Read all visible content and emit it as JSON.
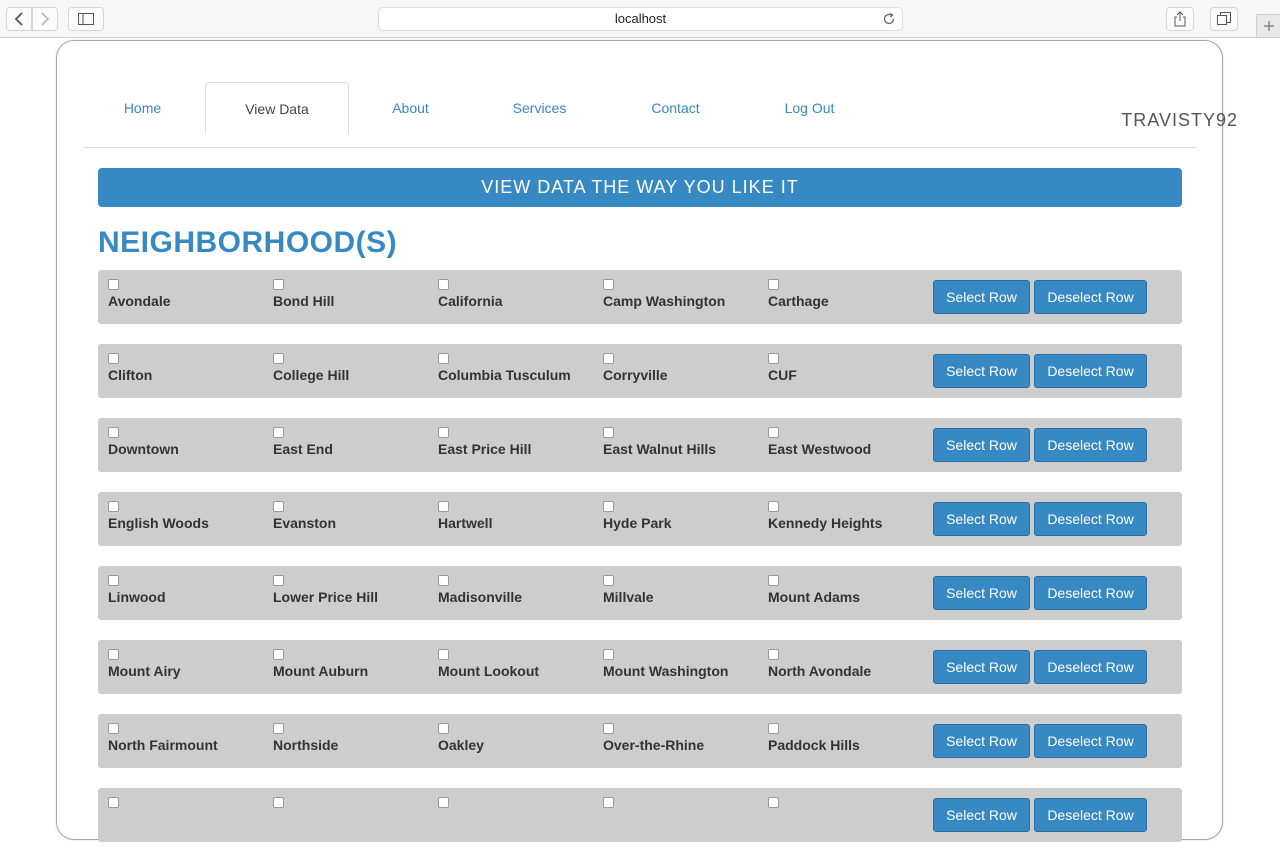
{
  "browser": {
    "url": "localhost"
  },
  "nav": {
    "tabs": [
      {
        "label": "Home",
        "active": false
      },
      {
        "label": "View Data",
        "active": true
      },
      {
        "label": "About",
        "active": false
      },
      {
        "label": "Services",
        "active": false
      },
      {
        "label": "Contact",
        "active": false
      },
      {
        "label": "Log Out",
        "active": false
      }
    ],
    "username": "TRAVISTY92"
  },
  "banner": "VIEW DATA THE WAY YOU LIKE IT",
  "section_title": "NEIGHBORHOOD(S)",
  "row_buttons": {
    "select": "Select Row",
    "deselect": "Deselect Row"
  },
  "rows": [
    [
      "Avondale",
      "Bond Hill",
      "California",
      "Camp Washington",
      "Carthage"
    ],
    [
      "Clifton",
      "College Hill",
      "Columbia Tusculum",
      "Corryville",
      "CUF"
    ],
    [
      "Downtown",
      "East End",
      "East Price Hill",
      "East Walnut Hills",
      "East Westwood"
    ],
    [
      "English Woods",
      "Evanston",
      "Hartwell",
      "Hyde Park",
      "Kennedy Heights"
    ],
    [
      "Linwood",
      "Lower Price Hill",
      "Madisonville",
      "Millvale",
      "Mount Adams"
    ],
    [
      "Mount Airy",
      "Mount Auburn",
      "Mount Lookout",
      "Mount Washington",
      "North Avondale"
    ],
    [
      "North Fairmount",
      "Northside",
      "Oakley",
      "Over-the-Rhine",
      "Paddock Hills"
    ],
    [
      "",
      "",
      "",
      "",
      ""
    ]
  ],
  "colors": {
    "accent": "#3789c4",
    "row_bg": "#cdcdcd"
  }
}
